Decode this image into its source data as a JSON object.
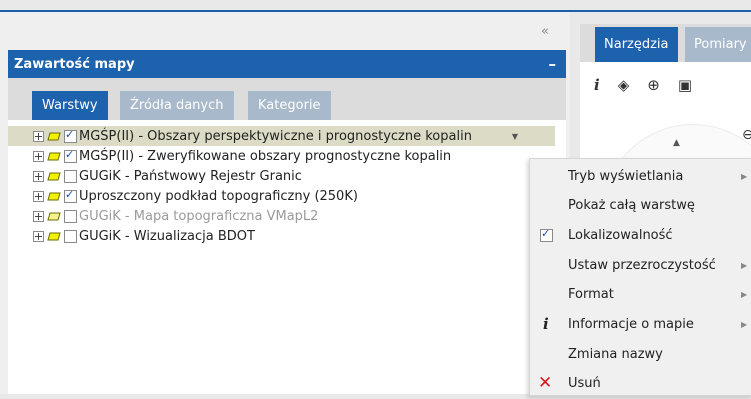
{
  "panel": {
    "title": "Zawartość mapy",
    "minimize": "–",
    "collapse": "«",
    "tabs": [
      {
        "label": "Warstwy",
        "active": true
      },
      {
        "label": "Źródła danych",
        "active": false
      },
      {
        "label": "Kategorie",
        "active": false
      }
    ]
  },
  "layers": [
    {
      "label": "MGŚP(II) - Obszary perspektywiczne i prognostyczne kopalin",
      "checked": true,
      "selected": true,
      "dim": false
    },
    {
      "label": "MGŚP(II) - Zweryfikowane obszary prognostyczne kopalin",
      "checked": true,
      "selected": false,
      "dim": false
    },
    {
      "label": "GUGiK - Państwowy Rejestr Granic",
      "checked": false,
      "selected": false,
      "dim": false
    },
    {
      "label": "Uproszczony podkład topograficzny (250K)",
      "checked": true,
      "selected": false,
      "dim": false
    },
    {
      "label": "GUGiK - Mapa topograficzna VMapL2",
      "checked": false,
      "selected": false,
      "dim": true
    },
    {
      "label": "GUGiK - Wizualizacja BDOT",
      "checked": false,
      "selected": false,
      "dim": false
    }
  ],
  "right_panel": {
    "tabs": [
      {
        "label": "Narzędzia",
        "active": true
      },
      {
        "label": "Pomiary",
        "active": false
      }
    ],
    "tools": [
      "info-icon",
      "layers-icon",
      "zoom-icon",
      "save-icon"
    ]
  },
  "context_menu": {
    "items": [
      {
        "label": "Tryb wyświetlania",
        "icon": "",
        "submenu": true
      },
      {
        "label": "Pokaż całą warstwę",
        "icon": "",
        "submenu": false
      },
      {
        "label": "Lokalizowalność",
        "icon": "checkbox",
        "submenu": false
      },
      {
        "label": "Ustaw przezroczystość",
        "icon": "",
        "submenu": true
      },
      {
        "label": "Format",
        "icon": "",
        "submenu": true
      },
      {
        "label": "Informacje o mapie",
        "icon": "info",
        "submenu": true
      },
      {
        "label": "Zmiana nazwy",
        "icon": "",
        "submenu": false
      },
      {
        "label": "Usuń",
        "icon": "delete",
        "submenu": false
      }
    ]
  },
  "colors": {
    "accent": "#1d62ad",
    "tab_inactive": "#a8b9cc",
    "selection": "#dcdcc6",
    "delete": "#d81c1c"
  }
}
